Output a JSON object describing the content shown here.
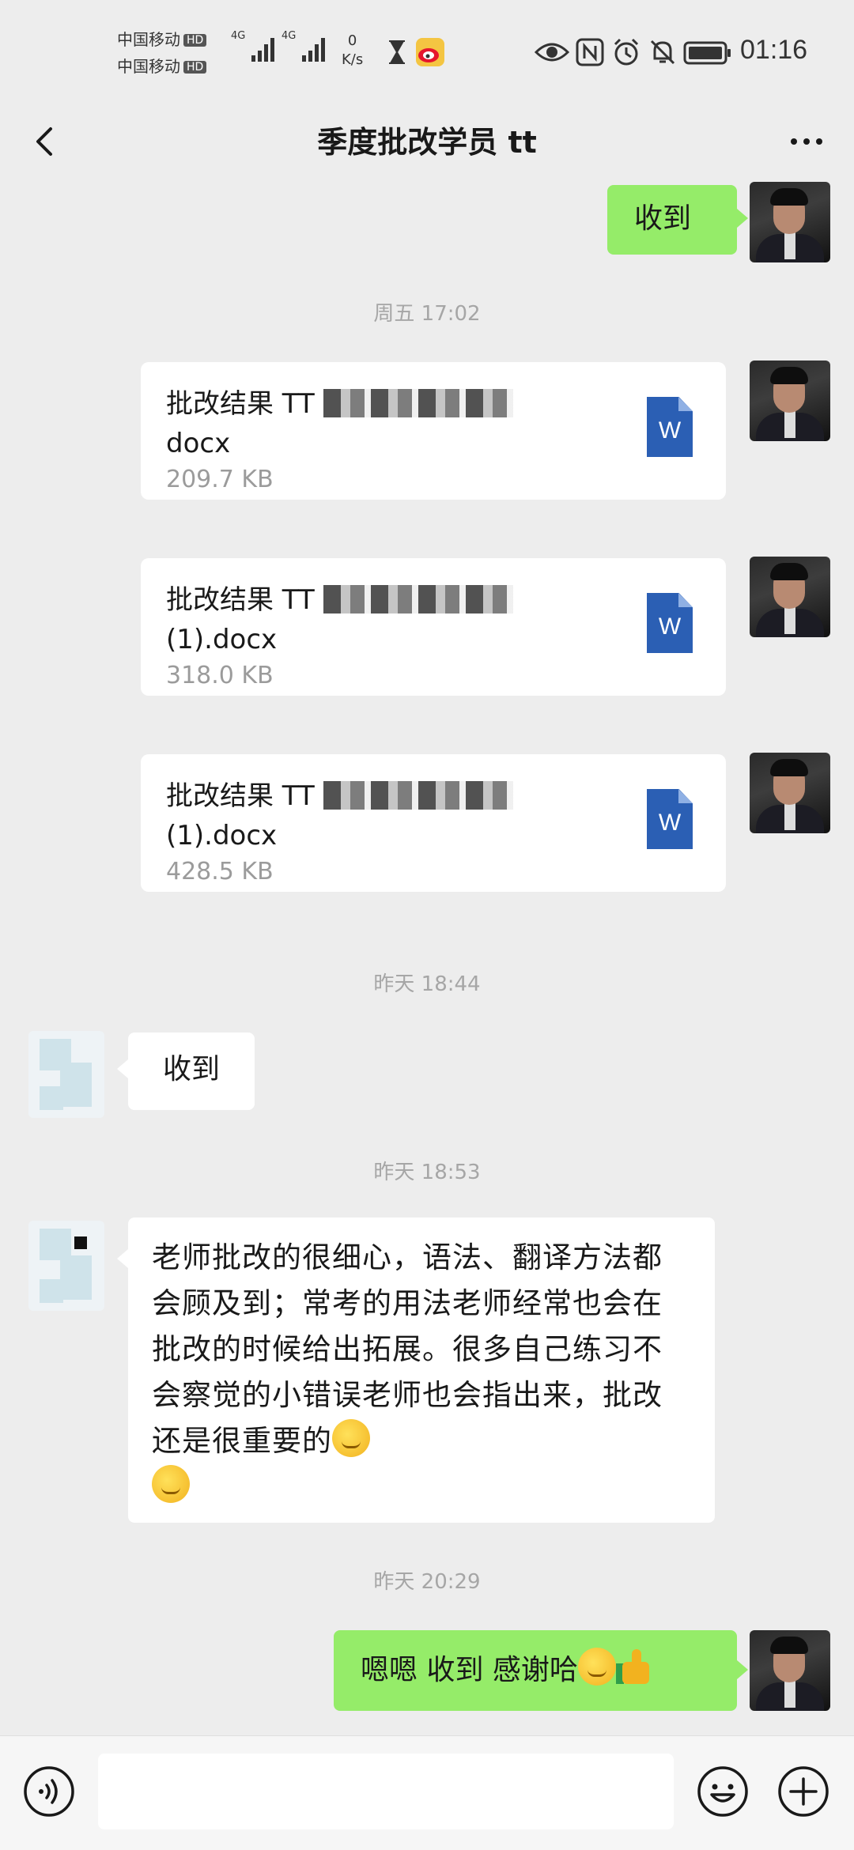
{
  "status_bar": {
    "carrier1": "中国移动",
    "carrier2": "中国移动",
    "hd": "HD",
    "net1": "4G",
    "net2": "4G",
    "speed_value": "0",
    "speed_unit": "K/s",
    "time": "01:16",
    "icons": [
      "hourglass-icon",
      "weibo-icon",
      "eye-icon",
      "nfc-icon",
      "alarm-icon",
      "mute-icon",
      "battery-icon"
    ]
  },
  "header": {
    "title": "季度批改学员 tt",
    "back_icon": "chevron-left-icon",
    "more_icon": "more-icon"
  },
  "messages": {
    "m1": "收到",
    "stamp1": "周五 17:02",
    "file1": {
      "name_prefix": "批改结果 TT",
      "name_suffix": "docx",
      "size": "209.7 KB"
    },
    "file2": {
      "name_prefix": "批改结果 TT",
      "name_suffix": "(1).docx",
      "size": "318.0 KB"
    },
    "file3": {
      "name_prefix": "批改结果 TT",
      "name_suffix": "(1).docx",
      "size": "428.5 KB"
    },
    "file_icon_label": "W",
    "stamp2": "昨天 18:44",
    "m2": "收到",
    "stamp3": "昨天 18:53",
    "m3": "老师批改的很细心，语法、翻译方法都会顾及到；常考的用法老师经常也会在批改的时候给出拓展。很多自己练习不会察觉的小错误老师也会指出来，批改还是很重要的",
    "stamp4": "昨天 20:29",
    "m4": "嗯嗯 收到 感谢哈"
  },
  "input_bar": {
    "voice_icon": "voice-icon",
    "emoji_icon": "emoji-icon",
    "plus_icon": "plus-icon"
  },
  "colors": {
    "background": "#ededed",
    "green_bubble": "#95ec69",
    "white_bubble": "#ffffff",
    "timestamp": "#a6a6a6",
    "word_blue": "#2b5fb4"
  }
}
